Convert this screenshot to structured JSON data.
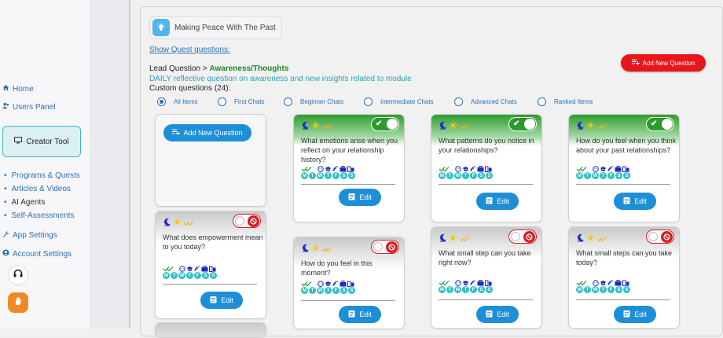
{
  "sidebar": {
    "home": "Home",
    "users_panel": "Users Panel",
    "creator_tool": "Creator Tool",
    "programs": "Programs & Quests",
    "articles": "Articles & Videos",
    "ai_agents": "AI Agents",
    "self_assessments": "Self-Assessments",
    "app_settings": "App Settings",
    "account_settings": "Account Settings"
  },
  "quest": {
    "name": "Making Peace With The Past",
    "show_link": "Show Quest questions:",
    "lead_prefix": "Lead Question >",
    "lead_topic": "Awareness/Thoughts",
    "daily_desc": "DAILY reflective question on awareness and new insights related to module",
    "custom_count": "Custom questions (24):"
  },
  "add_new_question_label": "Add New Question",
  "edit_label": "Edit",
  "filters": [
    "All Items",
    "First Chats",
    "Beginner Chats",
    "Intermediate Chats",
    "Advanced Chats",
    "Ranked Items"
  ],
  "selected_filter": "All Items",
  "day_letters": [
    "M",
    "T",
    "W",
    "T",
    "F",
    "S",
    "S"
  ],
  "cards": [
    {
      "question": "What emotions arise when you reflect on your relationship history?",
      "active": true
    },
    {
      "question": "What patterns do you notice in your relationships?",
      "active": true
    },
    {
      "question": "How do you feel when you think about your past relationships?",
      "active": true
    },
    {
      "question": "What does empowerment mean to you today?",
      "active": false
    },
    {
      "question": "How do you feel in this moment?",
      "active": false
    },
    {
      "question": "What small step can you take right now?",
      "active": false
    },
    {
      "question": "What small steps can you take today?",
      "active": false
    }
  ],
  "colors": {
    "accent": "#1e8fd6",
    "danger": "#e8161b",
    "active_green": "#2e9e2e",
    "link": "#2d6fb3",
    "day_chip": "#2cc0c8"
  },
  "icons": [
    "home-icon",
    "users-icon",
    "monitor-icon",
    "wrench-icon",
    "user-circle-icon",
    "headset-icon",
    "hand-icon",
    "lightbulb-icon",
    "playlist-add-icon",
    "pencil-icon",
    "moon-icon",
    "sun-icon",
    "check-icon",
    "ban-icon"
  ]
}
